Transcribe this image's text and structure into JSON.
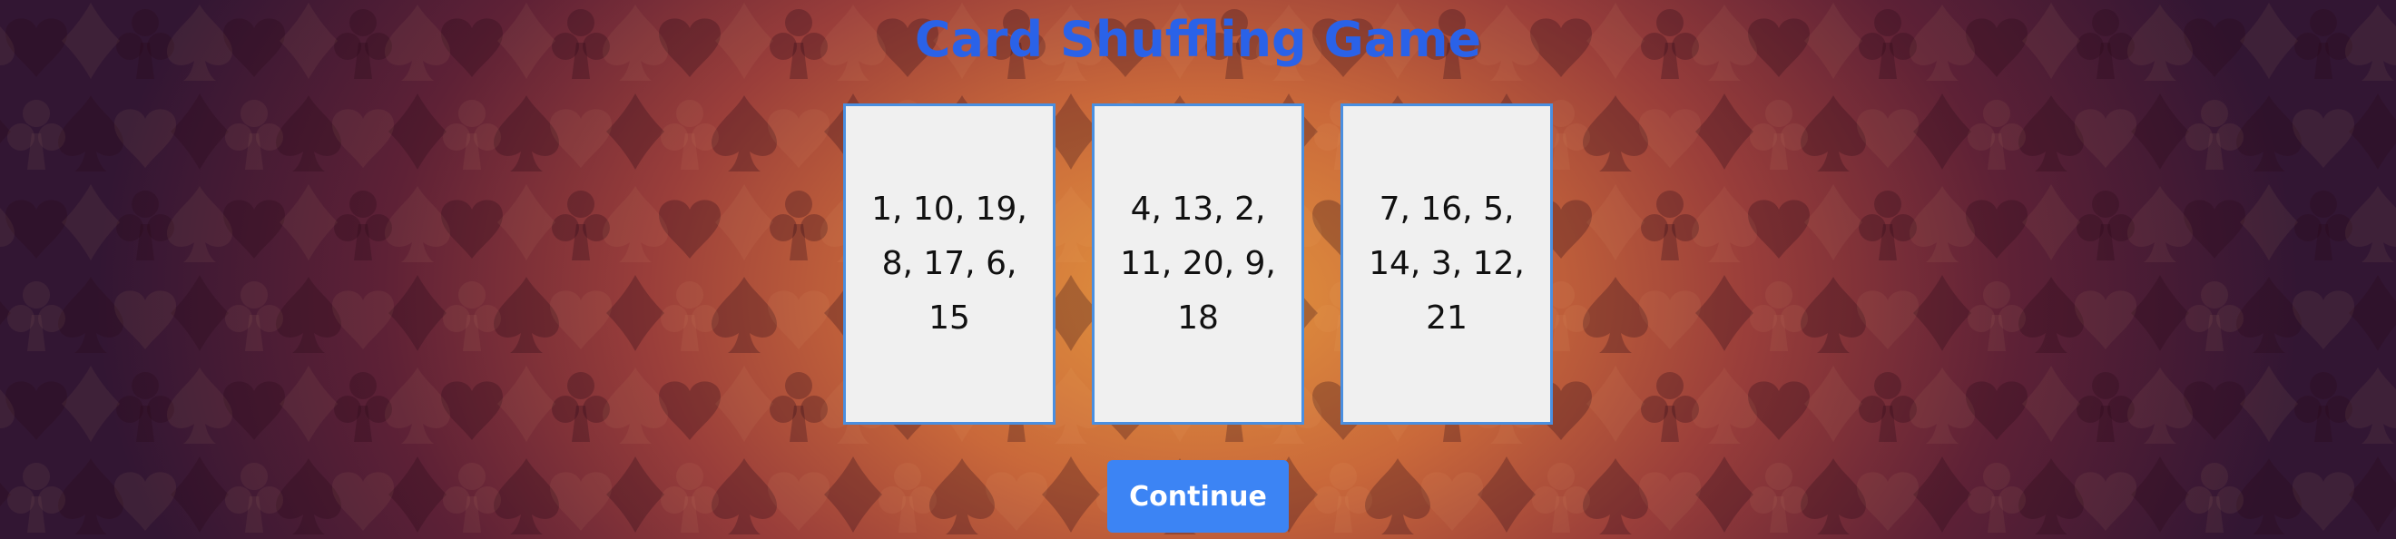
{
  "page": {
    "title": "Card Shuffling Game",
    "background": "playing-card-suits-pattern"
  },
  "colors": {
    "title": "#2a62e8",
    "card_border": "#4a8fe0",
    "card_fill": "#f0f0f0",
    "button": "#3c84f4",
    "background_center": "#e4963e",
    "background_edge": "#321633"
  },
  "cards": [
    {
      "text": "1, 10, 19, 8, 17, 6, 15"
    },
    {
      "text": "4, 13, 2, 11, 20, 9, 18"
    },
    {
      "text": "7, 16, 5, 14, 3, 12, 21"
    }
  ],
  "actions": {
    "continue_label": "Continue"
  }
}
